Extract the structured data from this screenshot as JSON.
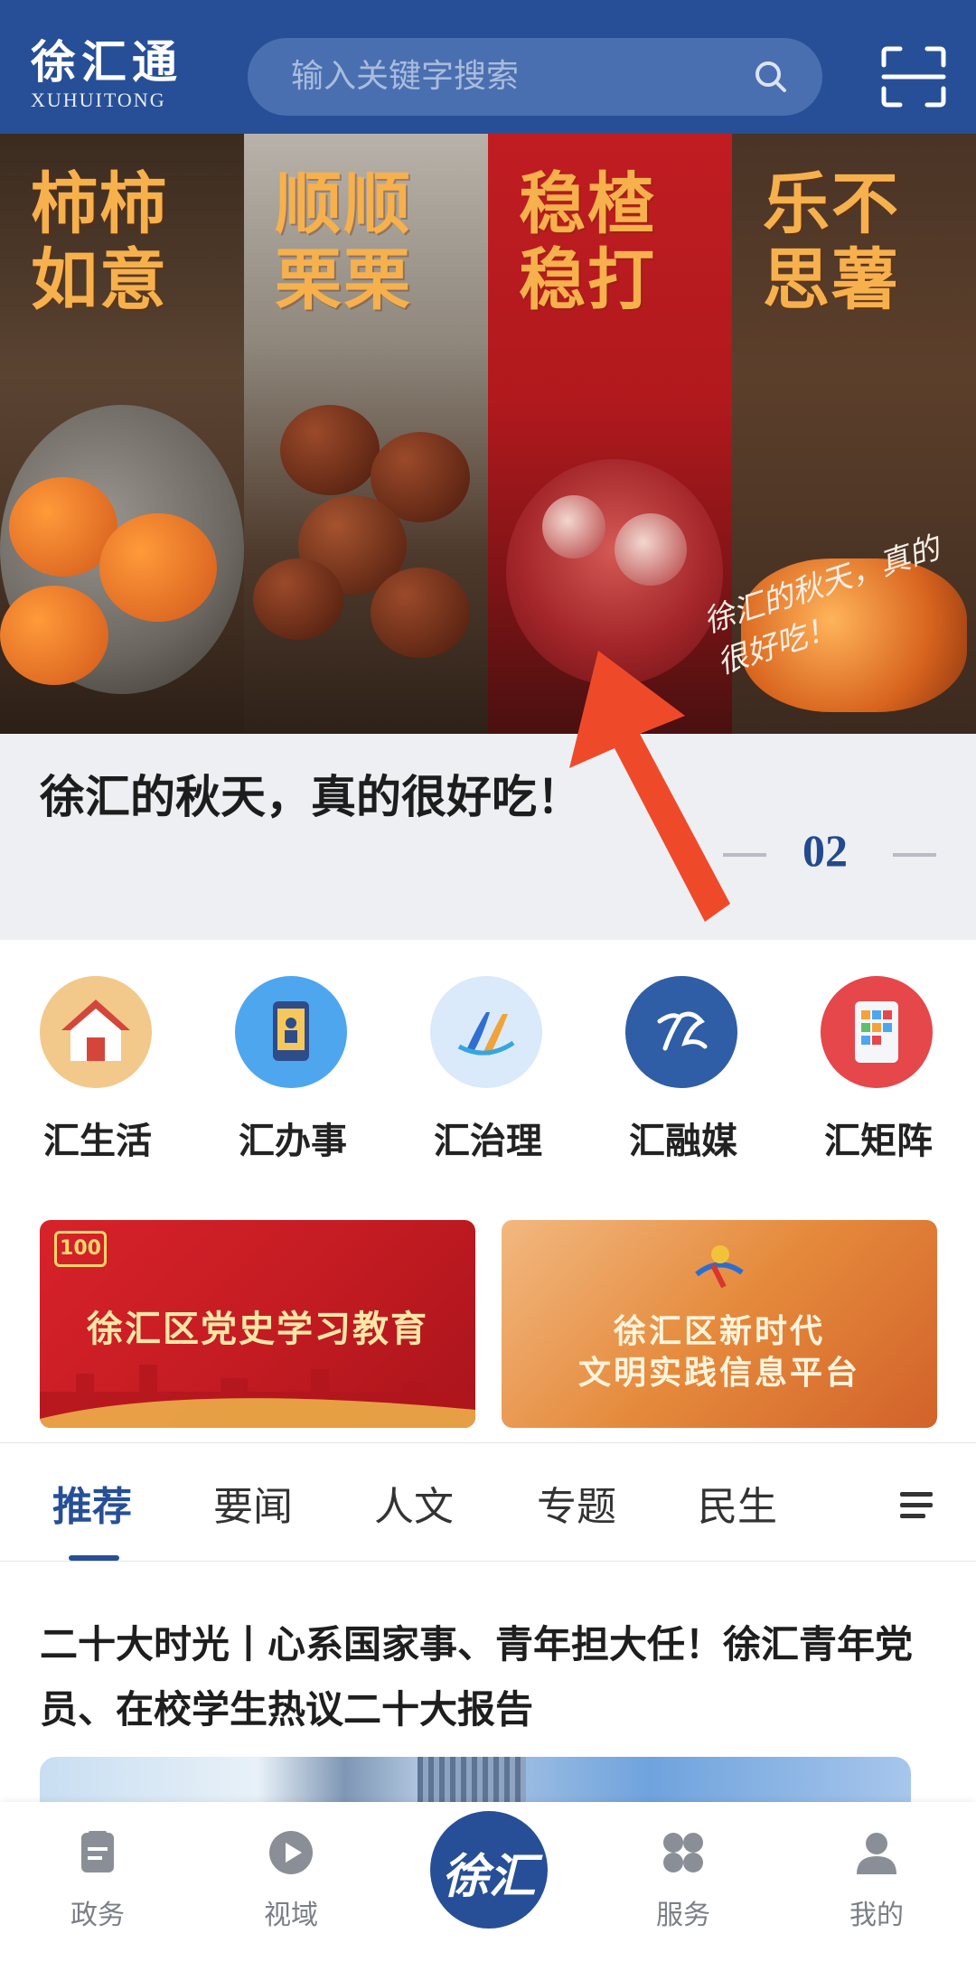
{
  "header": {
    "logo_cn": "徐汇通",
    "logo_en": "XUHUITONG",
    "search_placeholder": "输入关键字搜索",
    "search_icon": "search-icon",
    "scan_icon": "scan-icon"
  },
  "banner": {
    "panels": [
      "柿柿如意",
      "顺顺栗栗",
      "稳楂稳打",
      "乐不思薯"
    ],
    "script_text": "徐汇的秋天，真的很好吃！",
    "caption": "徐汇的秋天，真的很好吃！",
    "page_indicator": "02"
  },
  "quick_entries": [
    {
      "label": "汇生活",
      "icon": "house-icon",
      "color": "#f2c98a"
    },
    {
      "label": "汇办事",
      "icon": "phone-icon",
      "color": "#4ea6ee"
    },
    {
      "label": "汇治理",
      "icon": "governance-logo-icon",
      "color": "#dbeafa"
    },
    {
      "label": "汇融媒",
      "icon": "media-logo-icon",
      "color": "#2f5ea6"
    },
    {
      "label": "汇矩阵",
      "icon": "tablet-apps-icon",
      "color": "#e5474b"
    }
  ],
  "promos": [
    {
      "text": "徐汇区党史学习教育",
      "badge": "100"
    },
    {
      "line1": "徐汇区新时代",
      "line2": "文明实践信息平台"
    }
  ],
  "tabs": {
    "items": [
      "推荐",
      "要闻",
      "人文",
      "专题",
      "民生"
    ],
    "active": "推荐",
    "menu_icon": "menu-icon"
  },
  "article": {
    "title": "二十大时光丨心系国家事、青年担大任！徐汇青年党员、在校学生热议二十大报告"
  },
  "bottom_nav": {
    "items": [
      {
        "label": "政务",
        "icon": "document-icon"
      },
      {
        "label": "视域",
        "icon": "play-icon"
      },
      {
        "label": "服务",
        "icon": "grid-icon"
      },
      {
        "label": "我的",
        "icon": "person-icon"
      }
    ],
    "center_text": "徐汇"
  },
  "colors": {
    "brand_blue": "#264f97",
    "arrow_orange": "#ee4a2a"
  }
}
